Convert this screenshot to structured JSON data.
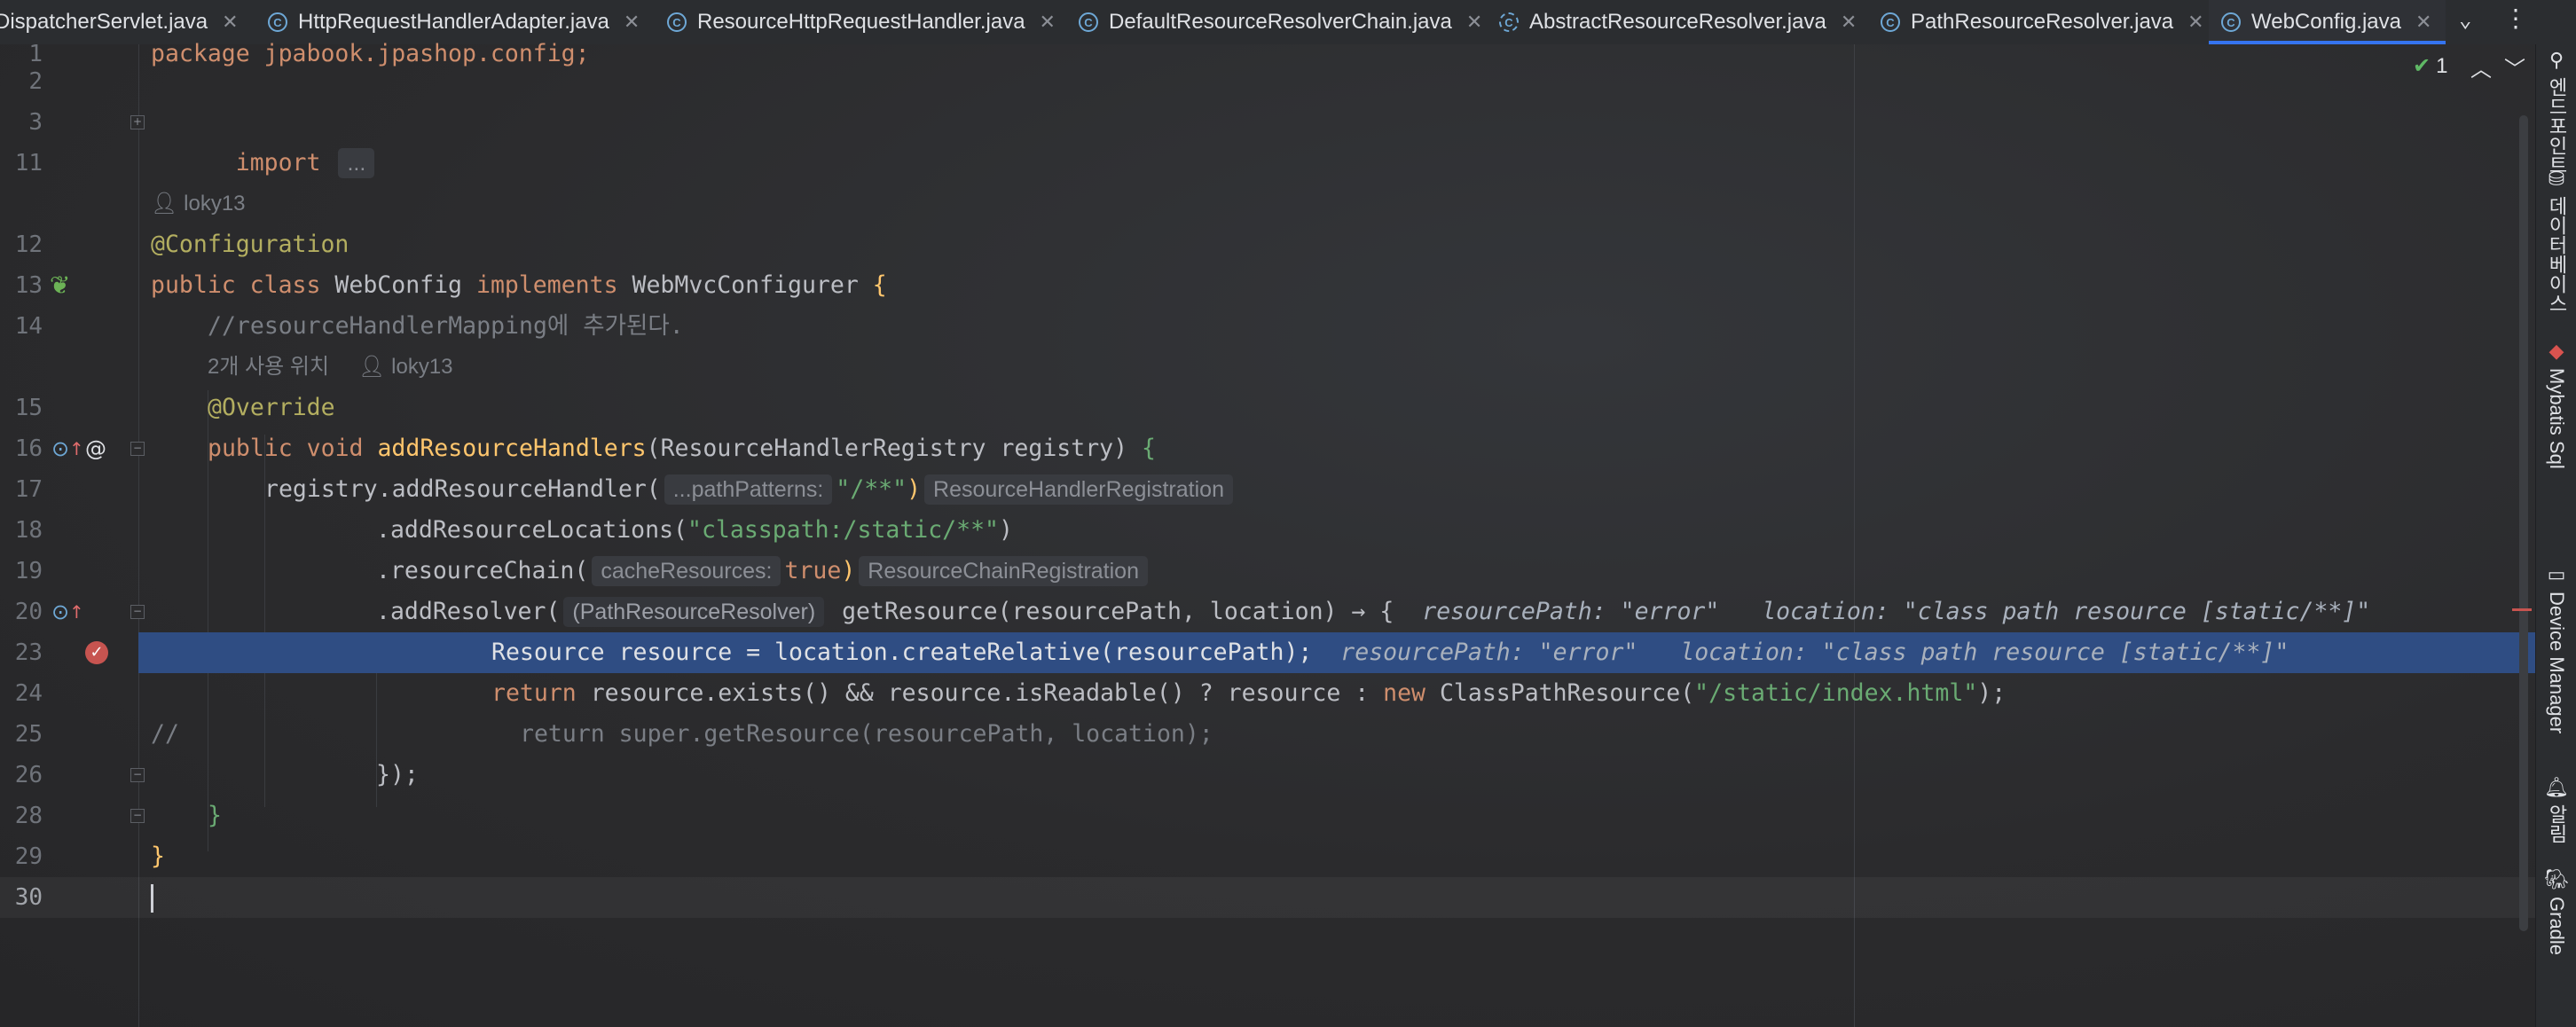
{
  "tabs": [
    {
      "label": "DispatcherServlet.java",
      "icon": "java-class-icon",
      "active": false
    },
    {
      "label": "HttpRequestHandlerAdapter.java",
      "icon": "java-class-icon",
      "active": false
    },
    {
      "label": "ResourceHttpRequestHandler.java",
      "icon": "java-class-icon",
      "active": false
    },
    {
      "label": "DefaultResourceResolverChain.java",
      "icon": "java-class-icon",
      "active": false
    },
    {
      "label": "AbstractResourceResolver.java",
      "icon": "java-abstract-class-icon",
      "active": false
    },
    {
      "label": "PathResourceResolver.java",
      "icon": "java-class-icon",
      "active": false
    },
    {
      "label": "WebConfig.java",
      "icon": "java-class-icon",
      "active": true
    }
  ],
  "inspection": {
    "count": "1"
  },
  "editor": {
    "line_numbers": [
      "1",
      "2",
      "3",
      "11",
      "12",
      "13",
      "14",
      "15",
      "16",
      "17",
      "18",
      "19",
      "20",
      "23",
      "24",
      "25",
      "26",
      "28",
      "29",
      "30"
    ],
    "author_hint_1": "loky13",
    "usage_hint": "2개 사용 위치",
    "author_hint_2": "loky13",
    "package_text": "package jpabook.jpashop.config;",
    "import_kw": "import",
    "import_fold": "...",
    "annotation_config": "@Configuration",
    "class_decl": {
      "kw1": "public class",
      "name": "WebConfig",
      "kw2": "implements",
      "iface": "WebMvcConfigurer",
      "brace": "{"
    },
    "comment_line": "//resourceHandlerMapping에 추가된다.",
    "annotation_override": "@Override",
    "method_decl": {
      "kw": "public void",
      "name": "addResourceHandlers",
      "params": "(ResourceHandlerRegistry registry)",
      "brace": "{"
    },
    "line17": {
      "pre": "registry.addResourceHandler(",
      "param_hint": "...pathPatterns:",
      "arg": "\"/**\"",
      "close": ")",
      "type_hint": "ResourceHandlerRegistration"
    },
    "line18": {
      "pre": ".addResourceLocations(",
      "arg": "\"classpath:/static/**\"",
      "close": ")"
    },
    "line19": {
      "pre": ".resourceChain(",
      "param_hint": "cacheResources:",
      "arg": "true",
      "close": ")",
      "type_hint": "ResourceChainRegistration"
    },
    "line20": {
      "pre": ".addResolver(",
      "cast": "(PathResourceResolver)",
      "code": " getResource(resourcePath, location) → {",
      "dbg1_label": "resourcePath:",
      "dbg1_value": "\"error\"",
      "dbg2_label": "location:",
      "dbg2_value": "\"class path resource [static/**]\""
    },
    "line23": {
      "code": "Resource resource = location.createRelative(resourcePath);",
      "dbg1_label": "resourcePath:",
      "dbg1_value": "\"error\"",
      "dbg2_label": "location:",
      "dbg2_value": "\"class path resource [static/**]\""
    },
    "line24": {
      "kw": "return",
      "code": " resource.exists() && resource.isReadable() ? resource : ",
      "kw_new": "new",
      "cls": " ClassPathResource(",
      "arg": "\"/static/index.html\"",
      "close": ");"
    },
    "line25": {
      "comment": "//",
      "code": "return super.getResource(resourcePath, location);"
    },
    "line26": "});",
    "line28": "}",
    "line29": "}"
  },
  "tool_windows": [
    {
      "label": "엔드포인트",
      "icon": "endpoints-icon"
    },
    {
      "label": "데이터베이스",
      "icon": "database-icon"
    },
    {
      "label": "Mybatis Sql",
      "icon": "mybatis-icon"
    },
    {
      "label": "Device Manager",
      "icon": "device-manager-icon"
    },
    {
      "label": "알림",
      "icon": "notifications-icon"
    },
    {
      "label": "Gradle",
      "icon": "gradle-icon"
    }
  ],
  "colors": {
    "background": "#2b2b2d",
    "keyword": "#cf8e6d",
    "annotation": "#b3ae60",
    "string": "#6aab73",
    "method_decl": "#ffc66d",
    "execution_line": "#2f4d83",
    "accent": "#3574f0"
  }
}
